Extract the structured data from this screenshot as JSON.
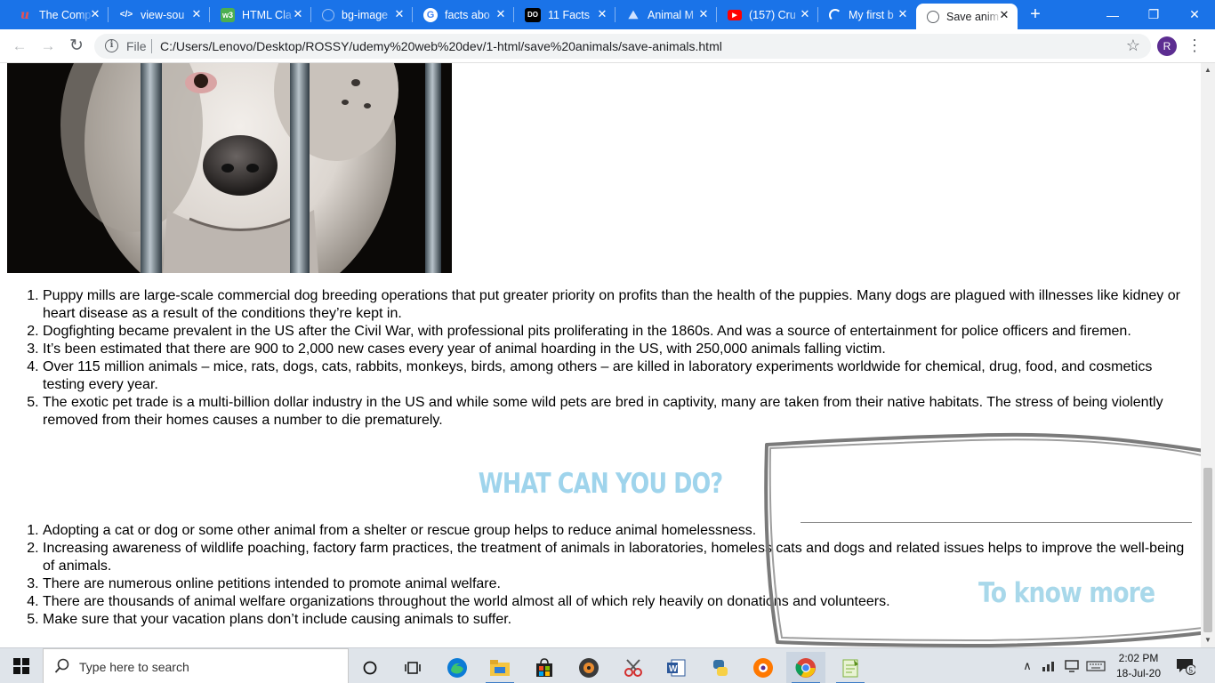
{
  "browser": {
    "tabs": [
      {
        "label": "The Comp",
        "icon": "udemy-icon",
        "active": false
      },
      {
        "label": "view-sou",
        "icon": "code-icon",
        "active": false
      },
      {
        "label": "HTML Cla",
        "icon": "w3schools-icon",
        "active": false
      },
      {
        "label": "bg-image",
        "icon": "globe-icon",
        "active": false
      },
      {
        "label": "facts abo",
        "icon": "google-icon",
        "active": false
      },
      {
        "label": "11 Facts",
        "icon": "dosomething-icon",
        "active": false
      },
      {
        "label": "Animal M",
        "icon": "animal-site-icon",
        "active": false
      },
      {
        "label": "(157) Cru",
        "icon": "youtube-icon",
        "active": false
      },
      {
        "label": "My first b",
        "icon": "loading-spinner-icon",
        "active": false
      },
      {
        "label": "Save anim",
        "icon": "globe-icon",
        "active": true
      }
    ],
    "new_tab_symbol": "+",
    "window_controls": {
      "minimize": "—",
      "restore": "❐",
      "close": "✕"
    },
    "toolbar": {
      "back_symbol": "←",
      "forward_symbol": "→",
      "reload_symbol": "↻",
      "info_symbol": "i",
      "file_label": "File",
      "url": "C:/Users/Lenovo/Desktop/ROSSY/udemy%20web%20dev/1-html/save%20animals/save-animals.html",
      "bookmark_symbol": "☆",
      "profile_initial": "R",
      "menu_symbol": "⋮"
    }
  },
  "page": {
    "facts": [
      "Puppy mills are large-scale commercial dog breeding operations that put greater priority on profits than the health of the puppies. Many dogs are plagued with illnesses like kidney or heart disease as a result of the conditions they’re kept in.",
      "Dogfighting became prevalent in the US after the Civil War, with professional pits proliferating in the 1860s. And was a source of entertainment for police officers and firemen.",
      "It’s been estimated that there are 900 to 2,000 new cases every year of animal hoarding in the US, with 250,000 animals falling victim.",
      "Over 115 million animals – mice, rats, dogs, cats, rabbits, monkeys, birds, among others – are killed in laboratory experiments worldwide for chemical, drug, food, and cosmetics testing every year.",
      "The exotic pet trade is a multi-billion dollar industry in the US and while some wild pets are bred in captivity, many are taken from their native habitats. The stress of being violently removed from their homes causes a number to die prematurely."
    ],
    "section_heading": "WHAT CAN YOU DO?",
    "actions": [
      "Adopting a cat or dog or some other animal from a shelter or rescue group helps to reduce animal homelessness.",
      "Increasing awareness of wildlife poaching, factory farm practices, the treatment of animals in laboratories, homeless cats and dogs and related issues helps to improve the well-being of animals.",
      "There are numerous online petitions intended to promote animal welfare.",
      "There are thousands of animal welfare organizations throughout the world almost all of which rely heavily on donations and volunteers.",
      "Make sure that your vacation plans don’t include causing animals to suffer."
    ],
    "know_more_label": "To know more",
    "colors": {
      "heading": "#9fd4ec",
      "know_more": "#a8d8ea",
      "tabstrip": "#1a73e8"
    }
  },
  "taskbar": {
    "search_placeholder": "Type here to search",
    "pinned": [
      "cortana-circle-icon",
      "task-view-icon",
      "edge-icon",
      "file-explorer-icon",
      "store-icon",
      "media-player-icon",
      "snipping-tool-icon",
      "word-icon",
      "python-icon",
      "avast-icon",
      "chrome-icon",
      "notepad-plus-icon"
    ],
    "time": "2:02 PM",
    "date": "18-Jul-20",
    "notification_count": "5"
  }
}
